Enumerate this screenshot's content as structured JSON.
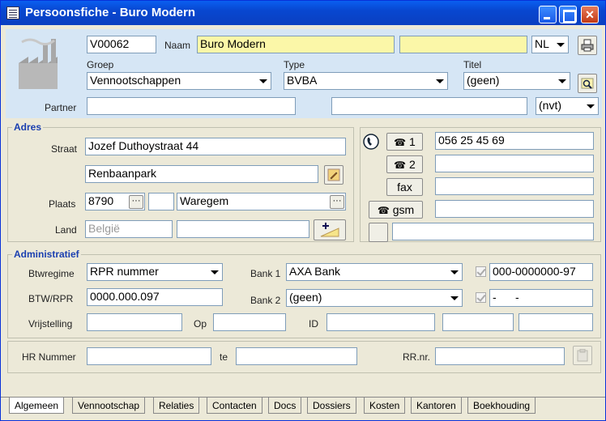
{
  "window": {
    "title": "Persoonsfiche - Buro Modern"
  },
  "header": {
    "code": "V00062",
    "naam_label": "Naam",
    "naam": "Buro Modern",
    "naam2": "",
    "language": "NL",
    "groep_label": "Groep",
    "groep": "Vennootschappen",
    "type_label": "Type",
    "type": "BVBA",
    "titel_label": "Titel",
    "titel": "(geen)",
    "partner_label": "Partner",
    "partner": "",
    "partner2": "",
    "partner_select": "(nvt)"
  },
  "adres": {
    "title": "Adres",
    "straat_label": "Straat",
    "straat": "Jozef Duthoystraat 44",
    "straat2": "Renbaanpark",
    "plaats_label": "Plaats",
    "postcode": "8790",
    "plaats": "Waregem",
    "land_label": "Land",
    "land": "België"
  },
  "phones": {
    "b1": "1",
    "v1": "056 25 45 69",
    "b2": "2",
    "v2": "",
    "fax": "fax",
    "vfax": "",
    "gsm": "gsm",
    "vgsm": "",
    "extra": ""
  },
  "admin": {
    "title": "Administratief",
    "btwregime_label": "Btwregime",
    "btwregime": "RPR nummer",
    "bank1_label": "Bank 1",
    "bank1": "AXA Bank",
    "bank1_nr": "000-0000000-97",
    "btw_label": "BTW/RPR",
    "btw": "0000.000.097",
    "bank2_label": "Bank 2",
    "bank2": "(geen)",
    "bank2_nr": "-      -",
    "vrijstelling_label": "Vrijstelling",
    "op_label": "Op",
    "id_label": "ID"
  },
  "hr": {
    "label": "HR Nummer",
    "te_label": "te",
    "rrnr_label": "RR.nr."
  },
  "tabs": [
    "Algemeen",
    "Vennootschap",
    "Relaties",
    "Contacten",
    "Docs",
    "Dossiers",
    "Kosten",
    "Kantoren",
    "Boekhouding"
  ]
}
